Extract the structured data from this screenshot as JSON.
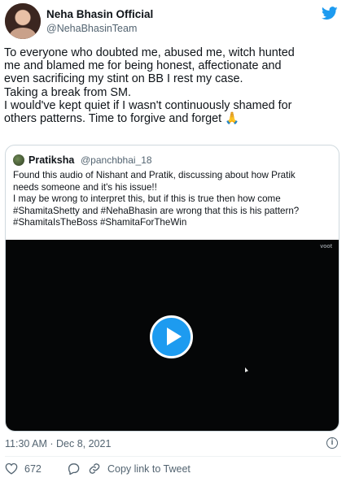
{
  "author": {
    "name": "Neha Bhasin Official",
    "handle": "@NehaBhasinTeam"
  },
  "tweet": {
    "lines": [
      "To everyone who doubted me, abused me, witch hunted",
      "me and blamed me for being honest, affectionate and",
      "even sacrificing my stint on BB I rest my case.",
      "Taking a break from SM.",
      "I would've kept quiet if I wasn't continuously shamed for",
      "others patterns. Time to forgive and forget 🙏"
    ]
  },
  "quoted": {
    "name": "Pratiksha",
    "handle": "@panchbhai_18",
    "lines": [
      "Found this audio of Nishant and Pratik, discussing about how Pratik",
      "needs someone and it's his issue!!",
      "I may be wrong to interpret this, but if this is true then how come",
      "#ShamitaShetty and #NehaBhasin are wrong that this is his pattern?",
      "#ShamitaIsTheBoss #ShamitaForTheWin"
    ],
    "video_watermark": "voot"
  },
  "timestamp": "11:30 AM · Dec 8, 2021",
  "info_label": "i",
  "actions": {
    "likes": "672",
    "copy_link": "Copy link to Tweet"
  },
  "colors": {
    "accent": "#1d9bf0",
    "secondary_text": "#536471",
    "border": "#cfd9de"
  },
  "icons": [
    "twitter-bird-icon",
    "play-icon",
    "info-icon",
    "heart-icon",
    "reply-icon",
    "link-icon"
  ]
}
